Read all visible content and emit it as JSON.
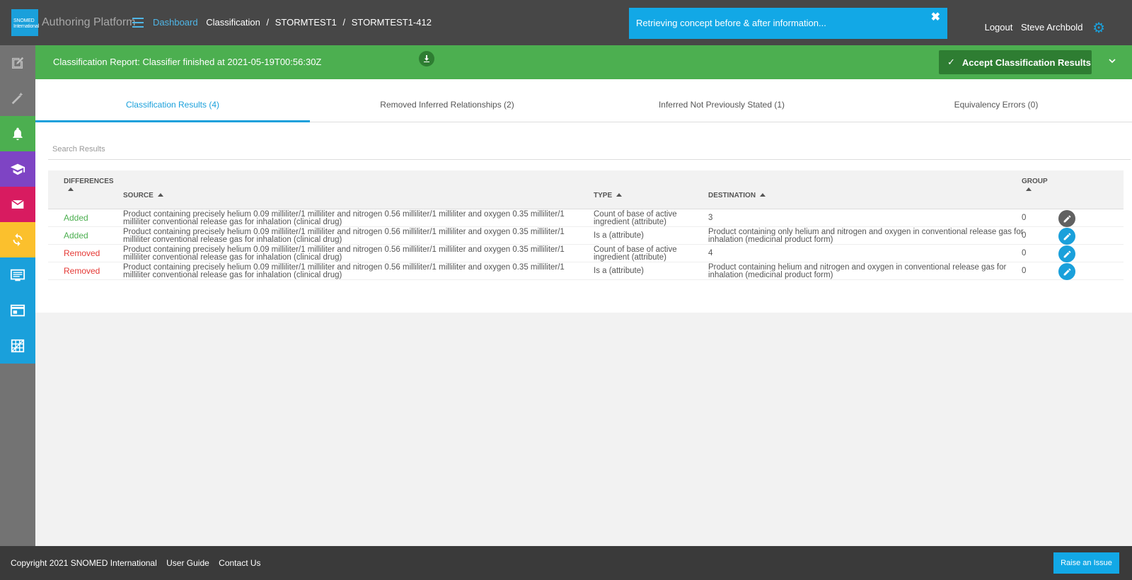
{
  "header": {
    "logo_text": "SNOMED International",
    "app_title": "Authoring Platform",
    "breadcrumb": {
      "dashboard": "Dashboard",
      "items": [
        "Classification",
        "/",
        "STORMTEST1",
        "/",
        "STORMTEST1-412"
      ]
    },
    "notification": "Retrieving concept before & after information...",
    "logout": "Logout",
    "user": "Steve Archbold"
  },
  "sidebar": {
    "items": [
      {
        "icon": "edit-icon",
        "bg": "#737373"
      },
      {
        "icon": "magic-wand-icon",
        "bg": "#737373"
      },
      {
        "icon": "bell-icon",
        "bg": "#4caf50"
      },
      {
        "icon": "graduation-cap-icon",
        "bg": "#7e44c4"
      },
      {
        "icon": "mail-icon",
        "bg": "#d81b60"
      },
      {
        "icon": "sync-icon",
        "bg": "#fbc02d"
      },
      {
        "icon": "monitor-list-icon",
        "bg": "#1aa0db"
      },
      {
        "icon": "browser-window-icon",
        "bg": "#1aa0db"
      },
      {
        "icon": "grid-icon",
        "bg": "#1aa0db"
      }
    ]
  },
  "classification": {
    "title": "Classification Report: Classifier finished at 2021-05-19T00:56:30Z",
    "accept_label": "Accept Classification Results",
    "tabs": [
      {
        "label": "Classification Results (4)",
        "active": true
      },
      {
        "label": "Removed Inferred Relationships (2)",
        "active": false
      },
      {
        "label": "Inferred Not Previously Stated (1)",
        "active": false
      },
      {
        "label": "Equivalency Errors (0)",
        "active": false
      }
    ],
    "search_placeholder": "Search Results",
    "columns": {
      "differences": "Differences",
      "source": "Source",
      "type": "Type",
      "destination": "Destination",
      "group": "Group"
    },
    "rows": [
      {
        "difference": "Added",
        "source": "Product containing precisely helium 0.09 milliliter/1 milliliter and nitrogen 0.56 milliliter/1 milliliter and oxygen 0.35 milliliter/1 milliliter conventional release gas for inhalation (clinical drug)",
        "type": "Count of base of active ingredient (attribute)",
        "destination": "3",
        "group": "0"
      },
      {
        "difference": "Added",
        "source": "Product containing precisely helium 0.09 milliliter/1 milliliter and nitrogen 0.56 milliliter/1 milliliter and oxygen 0.35 milliliter/1 milliliter conventional release gas for inhalation (clinical drug)",
        "type": "Is a (attribute)",
        "destination": "Product containing only helium and nitrogen and oxygen in conventional release gas for inhalation (medicinal product form)",
        "group": "0"
      },
      {
        "difference": "Removed",
        "source": "Product containing precisely helium 0.09 milliliter/1 milliliter and nitrogen 0.56 milliliter/1 milliliter and oxygen 0.35 milliliter/1 milliliter conventional release gas for inhalation (clinical drug)",
        "type": "Count of base of active ingredient (attribute)",
        "destination": "4",
        "group": "0"
      },
      {
        "difference": "Removed",
        "source": "Product containing precisely helium 0.09 milliliter/1 milliliter and nitrogen 0.56 milliliter/1 milliliter and oxygen 0.35 milliliter/1 milliliter conventional release gas for inhalation (clinical drug)",
        "type": "Is a (attribute)",
        "destination": "Product containing helium and nitrogen and oxygen in conventional release gas for inhalation (medicinal product form)",
        "group": "0"
      }
    ]
  },
  "footer": {
    "copyright": "Copyright 2021 SNOMED International",
    "user_guide": "User Guide",
    "contact": "Contact Us",
    "raise_issue": "Raise an Issue"
  },
  "colors": {
    "accent": "#1aa0db",
    "success": "#4caf50",
    "success_dark": "#2e7d32",
    "danger": "#e53935"
  }
}
